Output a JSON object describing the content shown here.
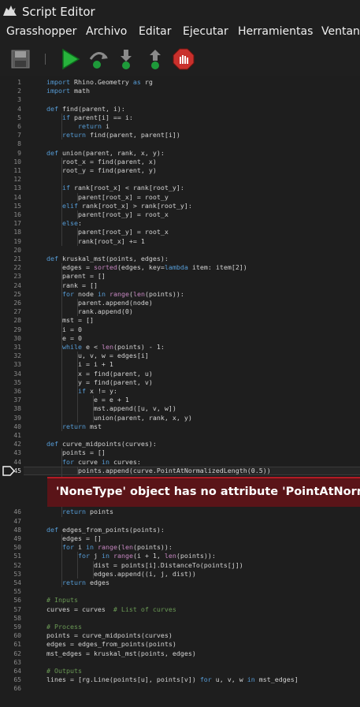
{
  "window": {
    "title": "Script Editor"
  },
  "menu": [
    "Grasshopper",
    "Archivo",
    "Editar",
    "Ejecutar",
    "Herramientas",
    "Ventana"
  ],
  "toolbar": {
    "items": [
      "save-icon",
      "run-icon",
      "step-over-icon",
      "step-into-icon",
      "step-out-icon",
      "stop-icon"
    ]
  },
  "editor": {
    "current_line": 45,
    "error_after_line": 45,
    "error_message": "'NoneType' object has no attribute 'PointAtNormalizedLength'",
    "lines": [
      "import Rhino.Geometry as rg",
      "import math",
      "",
      "def find(parent, i):",
      "    if parent[i] == i:",
      "        return i",
      "    return find(parent, parent[i])",
      "",
      "def union(parent, rank, x, y):",
      "    root_x = find(parent, x)",
      "    root_y = find(parent, y)",
      "",
      "    if rank[root_x] < rank[root_y]:",
      "        parent[root_x] = root_y",
      "    elif rank[root_x] > rank[root_y]:",
      "        parent[root_y] = root_x",
      "    else:",
      "        parent[root_y] = root_x",
      "        rank[root_x] += 1",
      "",
      "def kruskal_mst(points, edges):",
      "    edges = sorted(edges, key=lambda item: item[2])",
      "    parent = []",
      "    rank = []",
      "    for node in range(len(points)):",
      "        parent.append(node)",
      "        rank.append(0)",
      "    mst = []",
      "    i = 0",
      "    e = 0",
      "    while e < len(points) - 1:",
      "        u, v, w = edges[i]",
      "        i = i + 1",
      "        x = find(parent, u)",
      "        y = find(parent, v)",
      "        if x != y:",
      "            e = e + 1",
      "            mst.append([u, v, w])",
      "            union(parent, rank, x, y)",
      "    return mst",
      "",
      "def curve_midpoints(curves):",
      "    points = []",
      "    for curve in curves:",
      "        points.append(curve.PointAtNormalizedLength(0.5))",
      "    return points",
      "",
      "def edges_from_points(points):",
      "    edges = []",
      "    for i in range(len(points)):",
      "        for j in range(i + 1, len(points)):",
      "            dist = points[i].DistanceTo(points[j])",
      "            edges.append((i, j, dist))",
      "    return edges",
      "",
      "# Inputs",
      "curves = curves  # List of curves",
      "",
      "# Process",
      "points = curve_midpoints(curves)",
      "edges = edges_from_points(points)",
      "mst_edges = kruskal_mst(points, edges)",
      "",
      "# Outputs",
      "lines = [rg.Line(points[u], points[v]) for u, v, w in mst_edges]",
      ""
    ]
  }
}
